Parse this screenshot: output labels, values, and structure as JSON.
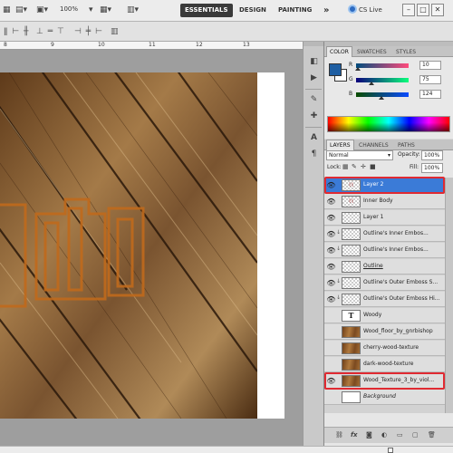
{
  "appbar": {
    "zoom": "100%",
    "workspaces": [
      "ESSENTIALS",
      "DESIGN",
      "PAINTING"
    ],
    "more": "»",
    "cslive": "CS Live",
    "window_buttons": [
      "–",
      "□",
      "✕"
    ]
  },
  "colors": {
    "accent": "#3b7bd7",
    "highlight": "#e02a32",
    "fg_swatch": "#1f5fa3"
  },
  "ruler": {
    "ticks": [
      "8",
      "9",
      "10",
      "11",
      "12",
      "13"
    ]
  },
  "color_panel": {
    "tabs": [
      "COLOR",
      "SWATCHES",
      "STYLES"
    ],
    "rows": [
      {
        "label": "R",
        "value": "10",
        "level": 0.04
      },
      {
        "label": "G",
        "value": "75",
        "level": 0.29
      },
      {
        "label": "B",
        "value": "124",
        "level": 0.49
      }
    ]
  },
  "layers_panel": {
    "tabs": [
      "LAYERS",
      "CHANNELS",
      "PATHS"
    ],
    "blend_mode": "Normal",
    "opacity_label": "Opacity:",
    "opacity_value": "100%",
    "lock_label": "Lock:",
    "fill_label": "Fill:",
    "fill_value": "100%",
    "layers": [
      {
        "name": "Layer 2",
        "thumb": "fx",
        "visible": true,
        "selected": true,
        "link": false
      },
      {
        "name": "Inner Body",
        "thumb": "fx",
        "visible": true,
        "selected": false,
        "link": false
      },
      {
        "name": "Layer 1",
        "thumb": "checker",
        "visible": true,
        "selected": false,
        "link": false
      },
      {
        "name": "Outline's Inner Embos...",
        "thumb": "checker",
        "visible": true,
        "selected": false,
        "link": true
      },
      {
        "name": "Outline's Inner Embos...",
        "thumb": "checker",
        "visible": true,
        "selected": false,
        "link": true
      },
      {
        "name": "Outline",
        "thumb": "checker",
        "visible": true,
        "selected": false,
        "link": false,
        "underline": true
      },
      {
        "name": "Outline's Outer Emboss S...",
        "thumb": "checker",
        "visible": true,
        "selected": false,
        "link": true
      },
      {
        "name": "Outline's Outer Emboss Hi...",
        "thumb": "checker",
        "visible": true,
        "selected": false,
        "link": true
      },
      {
        "name": "Woody",
        "thumb": "text",
        "visible": false,
        "selected": false,
        "link": false
      },
      {
        "name": "Wood_floor_by_gnrbishop",
        "thumb": "wood",
        "visible": false,
        "selected": false,
        "link": false
      },
      {
        "name": "cherry-wood-texture",
        "thumb": "wood",
        "visible": false,
        "selected": false,
        "link": false
      },
      {
        "name": "dark-wood-texture",
        "thumb": "wood",
        "visible": false,
        "selected": false,
        "link": false
      },
      {
        "name": "Wood_Texture_3_by_viol...",
        "thumb": "wood",
        "visible": true,
        "selected": false,
        "link": false
      },
      {
        "name": "Background",
        "thumb": "white",
        "visible": false,
        "selected": false,
        "link": false,
        "italic": true
      }
    ],
    "footer_icons": [
      "link-icon",
      "fx-icon",
      "mask-icon",
      "adjustment-icon",
      "group-icon",
      "new-layer-icon",
      "trash-icon"
    ]
  }
}
